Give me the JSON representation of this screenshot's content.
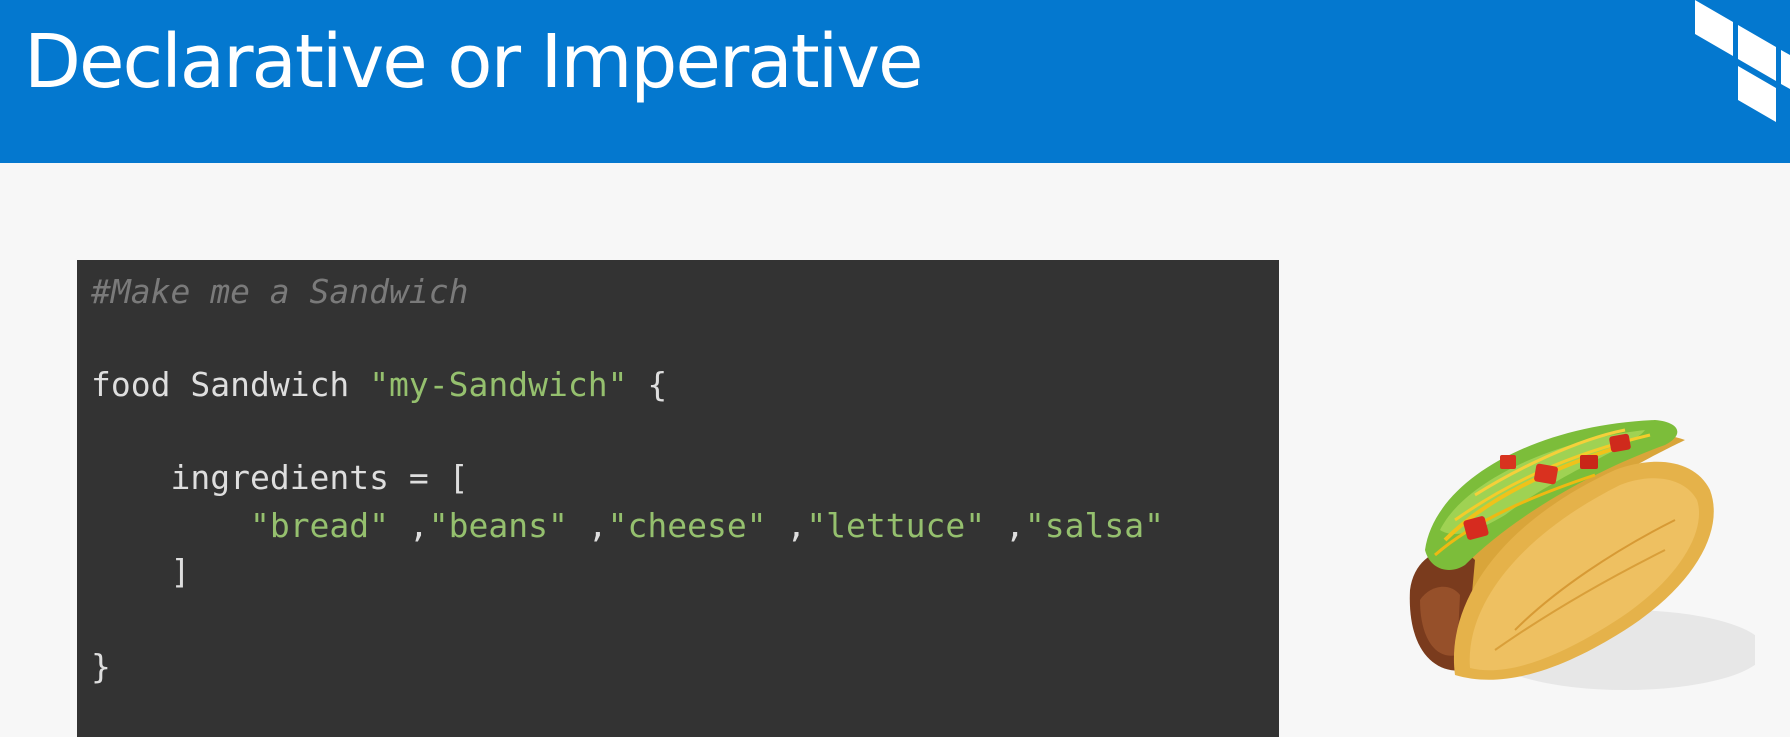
{
  "slide": {
    "title": "Declarative or Imperative",
    "header_color": "#0478cf",
    "logo_icon": "terraform-logo-icon",
    "image_icon": "taco-image"
  },
  "code": {
    "comment": "#Make me a Sandwich",
    "keyword": "food",
    "type": "Sandwich",
    "name": "\"my-Sandwich\"",
    "open_brace": "{",
    "assign": "ingredients = [",
    "ingredients": [
      "\"bread\"",
      "\"beans\"",
      "\"cheese\"",
      "\"lettuce\"",
      "\"salsa\""
    ],
    "separator": " ,",
    "close_bracket": "]",
    "close_brace": "}",
    "colors": {
      "background": "#333333",
      "text": "#dedede",
      "string": "#95c06e",
      "comment": "#7a7a7a"
    }
  }
}
